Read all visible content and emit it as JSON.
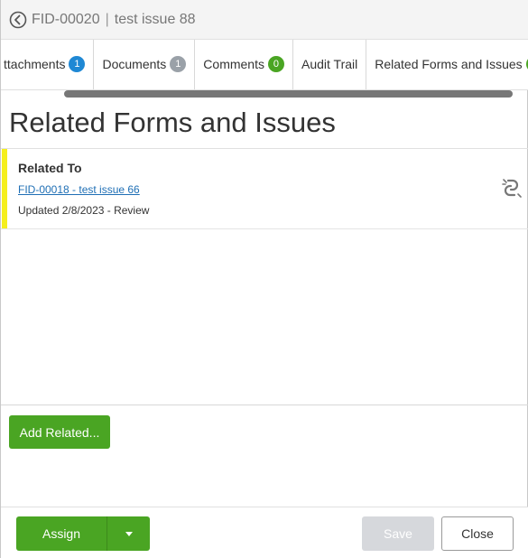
{
  "header": {
    "record_id": "FID-00020",
    "separator": "|",
    "record_title": "test issue 88",
    "back_icon": "back-circle-icon"
  },
  "tabs": [
    {
      "label": "ttachments",
      "badge": "1",
      "badge_color": "#1f88d4"
    },
    {
      "label": "Documents",
      "badge": "1",
      "badge_color": "#9aa1a8"
    },
    {
      "label": "Comments",
      "badge": "0",
      "badge_color": "#4aa523"
    },
    {
      "label": "Audit Trail",
      "badge": null
    },
    {
      "label": "Related Forms and Issues",
      "badge": "",
      "badge_color": "#4aa523"
    }
  ],
  "section": {
    "title": "Related Forms and Issues"
  },
  "related_items": [
    {
      "heading": "Related To",
      "link_text": "FID-00018 - test issue 66",
      "status": "Updated 2/8/2023 - Review",
      "accent_color": "#f5ef1e",
      "action_icon": "unlink-icon"
    }
  ],
  "actions": {
    "add_related_label": "Add Related...",
    "assign_label": "Assign",
    "save_label": "Save",
    "close_label": "Close"
  },
  "colors": {
    "primary_green": "#4aa523",
    "link_blue": "#1f6fb5",
    "disabled_gray": "#d6d8dc"
  }
}
